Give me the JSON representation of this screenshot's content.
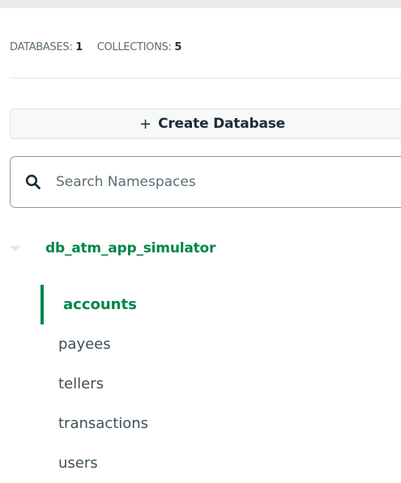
{
  "stats": {
    "databases_label": "DATABASES:",
    "databases_count": "1",
    "collections_label": "COLLECTIONS:",
    "collections_count": "5"
  },
  "create_database": {
    "plus": "+",
    "label": "Create Database"
  },
  "search": {
    "placeholder": "Search Namespaces",
    "value": ""
  },
  "database": {
    "name": "db_atm_app_simulator",
    "expanded": true
  },
  "collections": [
    {
      "name": "accounts",
      "active": true
    },
    {
      "name": "payees",
      "active": false
    },
    {
      "name": "tellers",
      "active": false
    },
    {
      "name": "transactions",
      "active": false
    },
    {
      "name": "users",
      "active": false
    }
  ],
  "colors": {
    "accent": "#00864a",
    "text": "#3d4f58",
    "border": "#8a979d"
  }
}
